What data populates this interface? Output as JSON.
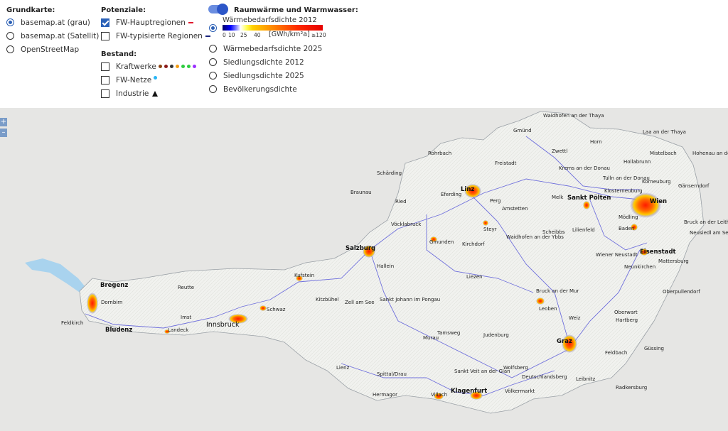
{
  "basemap": {
    "title": "Grundkarte:",
    "options": [
      "basemap.at (grau)",
      "basemap.at (Satellit)",
      "OpenStreetMap"
    ],
    "selected": "basemap.at (grau)"
  },
  "potenziale": {
    "title": "Potenziale:",
    "items": [
      {
        "label": "FW-Hauptregionen",
        "checked": true,
        "marker_color": "#e0182d"
      },
      {
        "label": "FW-typisierte Regionen",
        "checked": false,
        "marker_color": "#1a237e"
      }
    ]
  },
  "bestand": {
    "title": "Bestand:",
    "items": [
      {
        "label": "Kraftwerke",
        "checked": false,
        "marker_colors": [
          "#8b4513",
          "#8b1a1a",
          "#333333",
          "#f39c12",
          "#2ecc40",
          "#2ecc40",
          "#9b30ff"
        ]
      },
      {
        "label": "FW-Netze",
        "checked": false,
        "marker_color": "#29b6f6"
      },
      {
        "label": "Industrie",
        "checked": false,
        "marker": "triangle-icon"
      }
    ]
  },
  "heat": {
    "title": "Raumwärme und Warmwasser:",
    "toggle_on": true,
    "options": [
      "Wärmebedarfsdichte 2012",
      "Wärmebedarfsdichte 2025",
      "Siedlungsdichte 2012",
      "Siedlungsdichte 2025",
      "Bevölkerungsdichte"
    ],
    "selected": "Wärmebedarfsdichte 2012",
    "scale_labels": [
      "0",
      "10",
      "25",
      "40",
      "≥120"
    ],
    "unit": "[GWh/km²a]"
  },
  "map": {
    "zoom_in": "+",
    "zoom_out": "–",
    "places": [
      "Waidhofen an der Thaya",
      "Gmünd",
      "Horn",
      "Laa an der Thaya",
      "Mistelbach",
      "Hohenau an der March",
      "Rohrbach",
      "Zwettl",
      "Freistadt",
      "Krems an der Donau",
      "Tulln an der Donau",
      "Hollabrunn",
      "Korneuburg",
      "Gänserndorf",
      "Schärding",
      "Braunau",
      "Ried",
      "Eferding",
      "Linz",
      "Perg",
      "Amstetten",
      "Melk",
      "Sankt Pölten",
      "Klosterneuburg",
      "Wien",
      "Vöcklabruck",
      "Gmunden",
      "Steyr",
      "Kirchdorf",
      "Waidhofen an der Ybbs",
      "Scheibbs",
      "Lilienfeld",
      "Mödling",
      "Baden",
      "Bruck an der Leitha",
      "Neusiedl am See",
      "Salzburg",
      "Hallein",
      "Wiener Neustadt",
      "Eisenstadt",
      "Neunkirchen",
      "Mattersburg",
      "Bregenz",
      "Dornbirn",
      "Feldkirch",
      "Bludenz",
      "Reutte",
      "Kufstein",
      "Kitzbühel",
      "Zell am See",
      "Liezen",
      "Schwaz",
      "Innsbruck",
      "Imst",
      "Landeck",
      "Sankt Johann im Pongau",
      "Bruck an der Mur",
      "Leoben",
      "Oberwart",
      "Oberpullendorf",
      "Hartberg",
      "Judenburg",
      "Murau",
      "Tamsweg",
      "Weiz",
      "Graz",
      "Lienz",
      "Spittal/Drau",
      "Feldbach",
      "Güssing",
      "Sankt Veit an der Glan",
      "Wolfsberg",
      "Deutschlandsberg",
      "Leibnitz",
      "Radkersburg",
      "Villach",
      "Klagenfurt",
      "Völkermarkt",
      "Hermagor"
    ]
  }
}
